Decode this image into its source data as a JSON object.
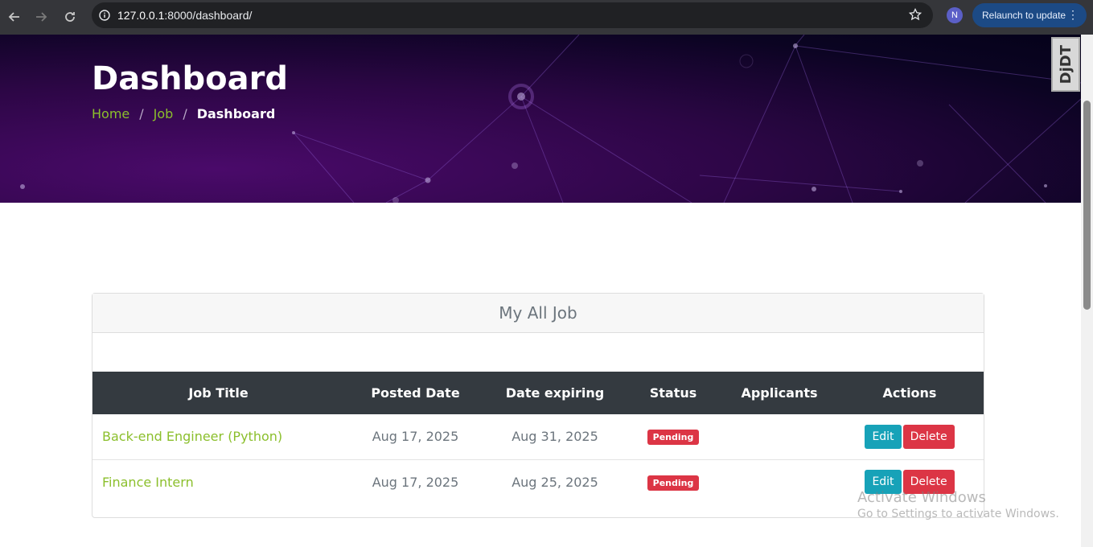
{
  "browser": {
    "url_host": "127.0.0.1",
    "url_rest": ":8000/dashboard/",
    "profile_initial": "N",
    "relaunch_label": "Relaunch to update"
  },
  "hero": {
    "title": "Dashboard",
    "breadcrumb": [
      "Home",
      "Job",
      "Dashboard"
    ],
    "separator": "/",
    "logo_text": "DjDT"
  },
  "card": {
    "header": "My All Job",
    "columns": [
      "Job Title",
      "Posted Date",
      "Date expiring",
      "Status",
      "Applicants",
      "Actions"
    ],
    "rows": [
      {
        "title": "Back-end Engineer (Python)",
        "posted": "Aug 17, 2025",
        "expiring": "Aug 31, 2025",
        "status": "Pending",
        "applicants": "",
        "edit": "Edit",
        "delete": "Delete"
      },
      {
        "title": "Finance Intern",
        "posted": "Aug 17, 2025",
        "expiring": "Aug 25, 2025",
        "status": "Pending",
        "applicants": "",
        "edit": "Edit",
        "delete": "Delete"
      }
    ]
  },
  "watermark": {
    "line1": "Activate Windows",
    "line2": "Go to Settings to activate Windows."
  },
  "colors": {
    "link_green": "#8bbf2c",
    "table_header": "#343a40",
    "pending_badge": "#dc3545",
    "edit_button": "#17a2b8",
    "delete_button": "#dc3545"
  }
}
